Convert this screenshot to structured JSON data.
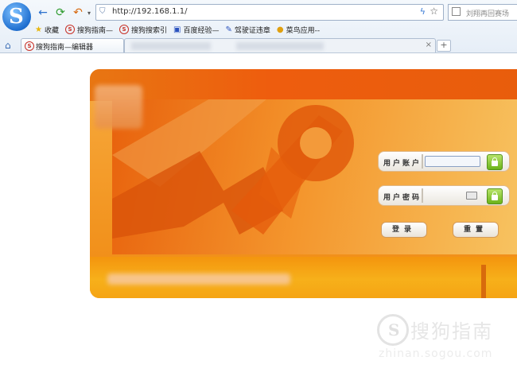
{
  "browser": {
    "address": "http://192.168.1.1/",
    "search_placeholder": "刘翔再回赛场",
    "bookmarks": [
      {
        "label": "收藏",
        "icon": "star-icon"
      },
      {
        "label": "搜狗指南—",
        "icon": "sogou-icon"
      },
      {
        "label": "搜狗搜索引",
        "icon": "sogou-icon"
      },
      {
        "label": "百度经验—",
        "icon": "baidu-icon"
      },
      {
        "label": "驾驶证违章",
        "icon": "pin-icon"
      },
      {
        "label": "菜鸟应用--",
        "icon": "bird-icon"
      }
    ],
    "tabs": [
      {
        "label": "搜狗指南—编辑器",
        "close": "×"
      },
      {
        "label": "",
        "close": "×"
      }
    ],
    "new_tab": "+"
  },
  "login": {
    "username_label": "用户账户",
    "password_label": "用户密码",
    "login_button": "登录",
    "reset_button": "重置"
  },
  "watermark": {
    "text": "搜狗指南",
    "url": "zhinan.sogou.com"
  },
  "colors": {
    "accent_orange": "#f08a12",
    "header_orange": "#ee5d0e",
    "lock_green": "#6cb319",
    "browser_blue": "#1f6fd0"
  }
}
